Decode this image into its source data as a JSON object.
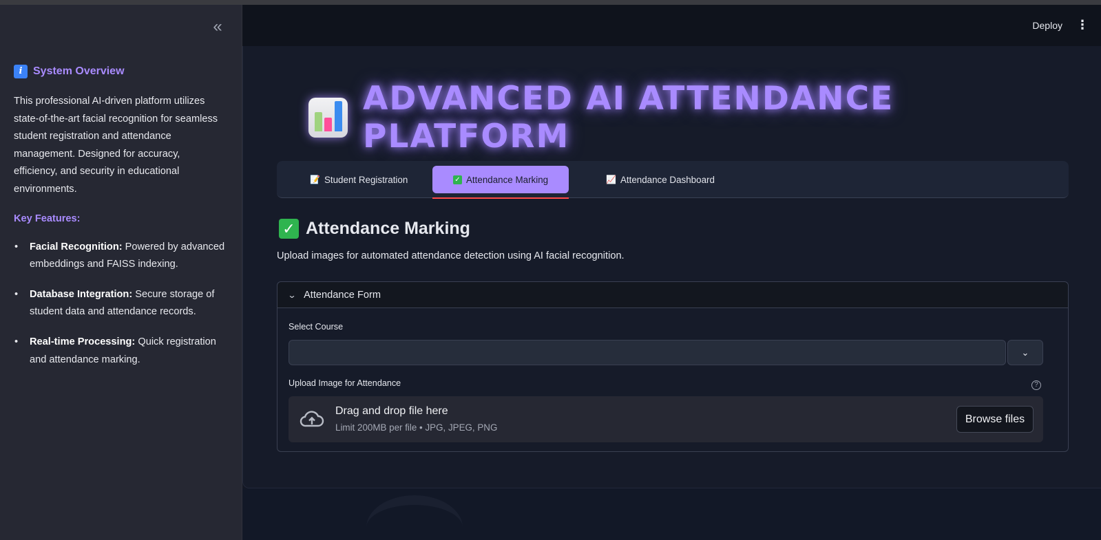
{
  "sidebar": {
    "collapse_icon": "«",
    "title": "System Overview",
    "description": "This professional AI-driven platform utilizes state-of-the-art facial recognition for seamless student registration and attendance management. Designed for accuracy, efficiency, and security in educational environments.",
    "key_features_label": "Key Features:",
    "features": [
      {
        "name": "Facial Recognition:",
        "text": " Powered by advanced embeddings and FAISS indexing."
      },
      {
        "name": "Database Integration:",
        "text": " Secure storage of student data and attendance records."
      },
      {
        "name": "Real-time Processing:",
        "text": " Quick registration and attendance marking."
      }
    ]
  },
  "header": {
    "deploy_label": "Deploy",
    "menu_icon": "⋮"
  },
  "hero": {
    "title": "ADVANCED AI ATTENDANCE PLATFORM"
  },
  "tabs": [
    {
      "label": "Student Registration",
      "icon": "📝"
    },
    {
      "label": "Attendance Marking",
      "icon": "✓"
    },
    {
      "label": "Attendance Dashboard",
      "icon": "📈"
    }
  ],
  "section": {
    "title": "Attendance Marking",
    "description": "Upload images for automated attendance detection using AI facial recognition."
  },
  "form": {
    "expander_label": "Attendance Form",
    "course_label": "Select Course",
    "course_value": "",
    "upload_label": "Upload Image for Attendance",
    "help_icon": "?",
    "drop_title": "Drag and drop file here",
    "drop_sub": "Limit 200MB per file • JPG, JPEG, PNG",
    "browse_label": "Browse files"
  },
  "colors": {
    "accent": "#a98bff",
    "tab_underline": "#ff4b4b",
    "check_green": "#2fb44f"
  }
}
